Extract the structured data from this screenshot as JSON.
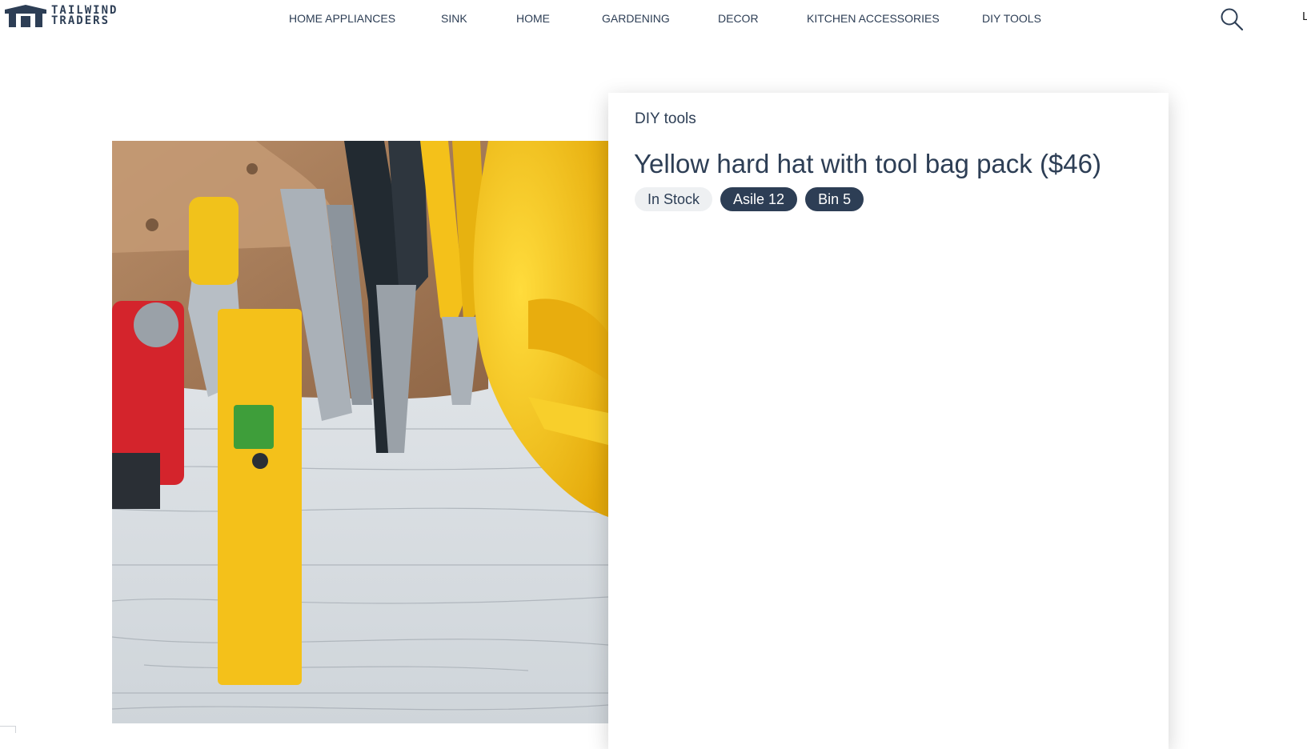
{
  "brand": {
    "line1": "TAILWIND",
    "line2": "TRADERS",
    "logo_icon": "house-logo-icon",
    "color": "#2d3e55"
  },
  "nav": {
    "items": [
      {
        "label": "HOME APPLIANCES"
      },
      {
        "label": "SINK"
      },
      {
        "label": "HOME"
      },
      {
        "label": "GARDENING"
      },
      {
        "label": "DECOR"
      },
      {
        "label": "KITCHEN ACCESSORIES"
      },
      {
        "label": "DIY TOOLS"
      }
    ],
    "search_icon": "search-icon",
    "edge_text": "L"
  },
  "product": {
    "image_alt": "Yellow hard hat with tool bag pack",
    "category": "DIY tools",
    "title": "Yellow hard hat with tool bag pack ($46)",
    "tags": [
      {
        "label": "In Stock",
        "style": "light"
      },
      {
        "label": "Asile 12",
        "style": "dark"
      },
      {
        "label": "Bin 5",
        "style": "dark"
      }
    ]
  },
  "colors": {
    "text": "#2d3e55",
    "tag_dark": "#2d3e55",
    "tag_light": "#eef0f2",
    "hat_yellow": "#f9c416",
    "tool_yellow": "#f4c11a"
  }
}
